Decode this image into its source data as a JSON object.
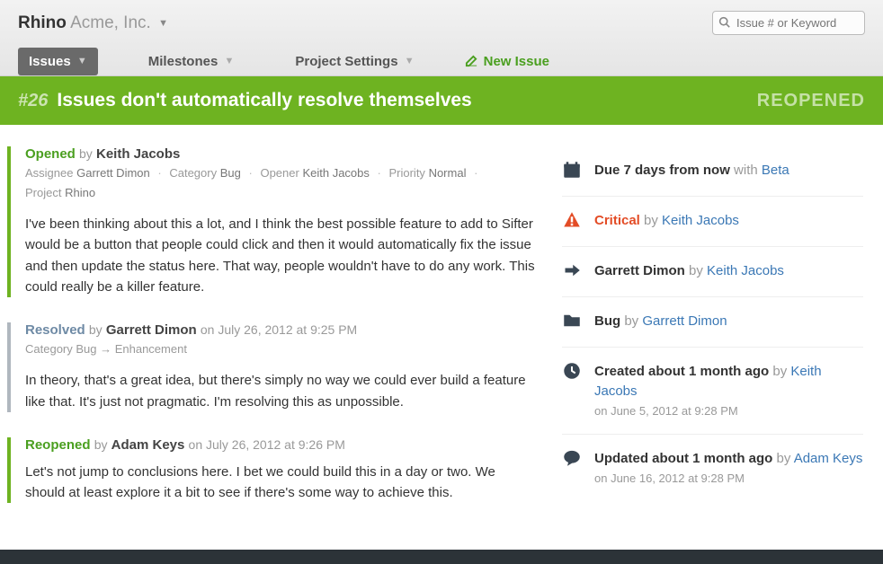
{
  "breadcrumb": {
    "project": "Rhino",
    "org": "Acme, Inc."
  },
  "search": {
    "placeholder": "Issue # or Keyword"
  },
  "nav": {
    "issues": "Issues",
    "milestones": "Milestones",
    "project_settings": "Project Settings",
    "new_issue": "New Issue"
  },
  "titlebar": {
    "number": "#26",
    "title": "Issues don't automatically resolve themselves",
    "status": "REOPENED"
  },
  "comments": [
    {
      "kind": "opened",
      "status": "Opened",
      "by": "by",
      "author": "Keith Jacobs",
      "date": "",
      "meta": [
        {
          "label": "Assignee",
          "value": "Garrett Dimon"
        },
        {
          "label": "Category",
          "value": "Bug"
        },
        {
          "label": "Opener",
          "value": "Keith Jacobs"
        },
        {
          "label": "Priority",
          "value": "Normal"
        },
        {
          "label": "Project",
          "value": "Rhino"
        }
      ],
      "body": "I've been thinking about this a lot, and I think the best possible feature to add to Sifter would be a button that people could click and then it would automatically fix the issue and then update the status here. That way, people wouldn't have to do any work. This could really be a killer feature."
    },
    {
      "kind": "resolved",
      "status": "Resolved",
      "by": "by",
      "author": "Garrett Dimon",
      "date": "on July 26, 2012 at 9:25 PM",
      "change": "Category Bug → Enhancement",
      "body": "In theory, that's a great idea, but there's simply no way we could ever build a feature like that. It's just not pragmatic. I'm resolving this as unpossible."
    },
    {
      "kind": "reopened",
      "status": "Reopened",
      "by": "by",
      "author": "Adam Keys",
      "date": "on July 26, 2012 at 9:26 PM",
      "body": "Let's not jump to conclusions here. I bet we could build this in a day or two. We should at least explore it a bit to see if there's some way to achieve this."
    }
  ],
  "sidebar": {
    "due": {
      "text": "Due 7 days from now",
      "with": "with",
      "link": "Beta"
    },
    "priority": {
      "label": "Critical",
      "by": "by",
      "user": "Keith Jacobs"
    },
    "assignee": {
      "name": "Garrett Dimon",
      "by": "by",
      "user": "Keith Jacobs"
    },
    "category": {
      "label": "Bug",
      "by": "by",
      "user": "Garrett Dimon"
    },
    "created": {
      "text": "Created about 1 month ago",
      "by": "by",
      "user": "Keith Jacobs",
      "sub": "on June 5, 2012 at 9:28 PM"
    },
    "updated": {
      "text": "Updated about 1 month ago",
      "by": "by",
      "user": "Adam Keys",
      "sub": "on June 16, 2012 at 9:28 PM"
    }
  }
}
